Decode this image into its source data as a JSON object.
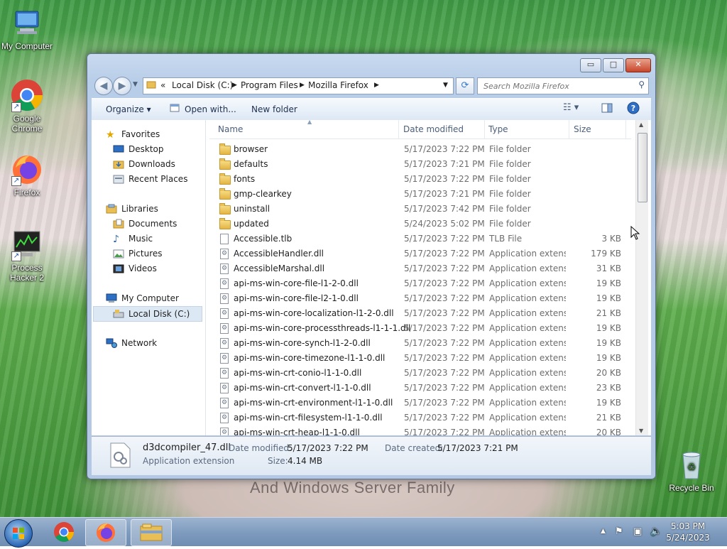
{
  "desktop": {
    "icons": [
      {
        "label": "My Computer",
        "icon": "computer-icon"
      },
      {
        "label": "Google Chrome",
        "icon": "chrome-icon"
      },
      {
        "label": "Firefox",
        "icon": "firefox-icon"
      },
      {
        "label": "Process Hacker 2",
        "icon": "process-hacker-icon"
      },
      {
        "label": "Recycle Bin",
        "icon": "recycle-bin-icon"
      }
    ],
    "wallpaper_text": "And Windows Server Family"
  },
  "window": {
    "controls": {
      "minimize": "▭",
      "maximize": "□",
      "close": "✕"
    },
    "breadcrumb": [
      "«",
      "Local Disk (C:)",
      "Program Files",
      "Mozilla Firefox"
    ],
    "search_placeholder": "Search Mozilla Firefox",
    "toolbar": {
      "organize": "Organize ▾",
      "open_with": "Open with...",
      "new_folder": "New folder"
    },
    "nav": {
      "favorites": "Favorites",
      "desktop": "Desktop",
      "downloads": "Downloads",
      "recent": "Recent Places",
      "libraries": "Libraries",
      "documents": "Documents",
      "music": "Music",
      "pictures": "Pictures",
      "videos": "Videos",
      "my_computer": "My Computer",
      "local_disk": "Local Disk (C:)",
      "network": "Network"
    },
    "columns": {
      "name": "Name",
      "date": "Date modified",
      "type": "Type",
      "size": "Size"
    },
    "files": [
      {
        "name": "browser",
        "date": "5/17/2023 7:22 PM",
        "type": "File folder",
        "size": "",
        "kind": "folder"
      },
      {
        "name": "defaults",
        "date": "5/17/2023 7:21 PM",
        "type": "File folder",
        "size": "",
        "kind": "folder"
      },
      {
        "name": "fonts",
        "date": "5/17/2023 7:22 PM",
        "type": "File folder",
        "size": "",
        "kind": "folder"
      },
      {
        "name": "gmp-clearkey",
        "date": "5/17/2023 7:21 PM",
        "type": "File folder",
        "size": "",
        "kind": "folder"
      },
      {
        "name": "uninstall",
        "date": "5/17/2023 7:42 PM",
        "type": "File folder",
        "size": "",
        "kind": "folder"
      },
      {
        "name": "updated",
        "date": "5/24/2023 5:02 PM",
        "type": "File folder",
        "size": "",
        "kind": "folder"
      },
      {
        "name": "Accessible.tlb",
        "date": "5/17/2023 7:22 PM",
        "type": "TLB File",
        "size": "3 KB",
        "kind": "file"
      },
      {
        "name": "AccessibleHandler.dll",
        "date": "5/17/2023 7:22 PM",
        "type": "Application extens...",
        "size": "179 KB",
        "kind": "dll"
      },
      {
        "name": "AccessibleMarshal.dll",
        "date": "5/17/2023 7:22 PM",
        "type": "Application extens...",
        "size": "31 KB",
        "kind": "dll"
      },
      {
        "name": "api-ms-win-core-file-l1-2-0.dll",
        "date": "5/17/2023 7:22 PM",
        "type": "Application extens...",
        "size": "19 KB",
        "kind": "dll"
      },
      {
        "name": "api-ms-win-core-file-l2-1-0.dll",
        "date": "5/17/2023 7:22 PM",
        "type": "Application extens...",
        "size": "19 KB",
        "kind": "dll"
      },
      {
        "name": "api-ms-win-core-localization-l1-2-0.dll",
        "date": "5/17/2023 7:22 PM",
        "type": "Application extens...",
        "size": "21 KB",
        "kind": "dll"
      },
      {
        "name": "api-ms-win-core-processthreads-l1-1-1.dll",
        "date": "5/17/2023 7:22 PM",
        "type": "Application extens...",
        "size": "19 KB",
        "kind": "dll"
      },
      {
        "name": "api-ms-win-core-synch-l1-2-0.dll",
        "date": "5/17/2023 7:22 PM",
        "type": "Application extens...",
        "size": "19 KB",
        "kind": "dll"
      },
      {
        "name": "api-ms-win-core-timezone-l1-1-0.dll",
        "date": "5/17/2023 7:22 PM",
        "type": "Application extens...",
        "size": "19 KB",
        "kind": "dll"
      },
      {
        "name": "api-ms-win-crt-conio-l1-1-0.dll",
        "date": "5/17/2023 7:22 PM",
        "type": "Application extens...",
        "size": "20 KB",
        "kind": "dll"
      },
      {
        "name": "api-ms-win-crt-convert-l1-1-0.dll",
        "date": "5/17/2023 7:22 PM",
        "type": "Application extens...",
        "size": "23 KB",
        "kind": "dll"
      },
      {
        "name": "api-ms-win-crt-environment-l1-1-0.dll",
        "date": "5/17/2023 7:22 PM",
        "type": "Application extens...",
        "size": "19 KB",
        "kind": "dll"
      },
      {
        "name": "api-ms-win-crt-filesystem-l1-1-0.dll",
        "date": "5/17/2023 7:22 PM",
        "type": "Application extens...",
        "size": "21 KB",
        "kind": "dll"
      },
      {
        "name": "api-ms-win-crt-heap-l1-1-0.dll",
        "date": "5/17/2023 7:22 PM",
        "type": "Application extens...",
        "size": "20 KB",
        "kind": "dll"
      }
    ],
    "details": {
      "filename": "d3dcompiler_47.dll",
      "type": "Application extension",
      "modified_label": "Date modified:",
      "modified": "5/17/2023 7:22 PM",
      "created_label": "Date created:",
      "created": "5/17/2023 7:21 PM",
      "size_label": "Size:",
      "size": "4.14 MB"
    }
  },
  "taskbar": {
    "apps": [
      "chrome-icon",
      "firefox-icon",
      "explorer-icon"
    ],
    "clock_time": "5:03 PM",
    "clock_date": "5/24/2023"
  },
  "colors": {
    "accent": "#3a78c8",
    "folder": "#e3b443",
    "selection": "#dde8f5"
  }
}
